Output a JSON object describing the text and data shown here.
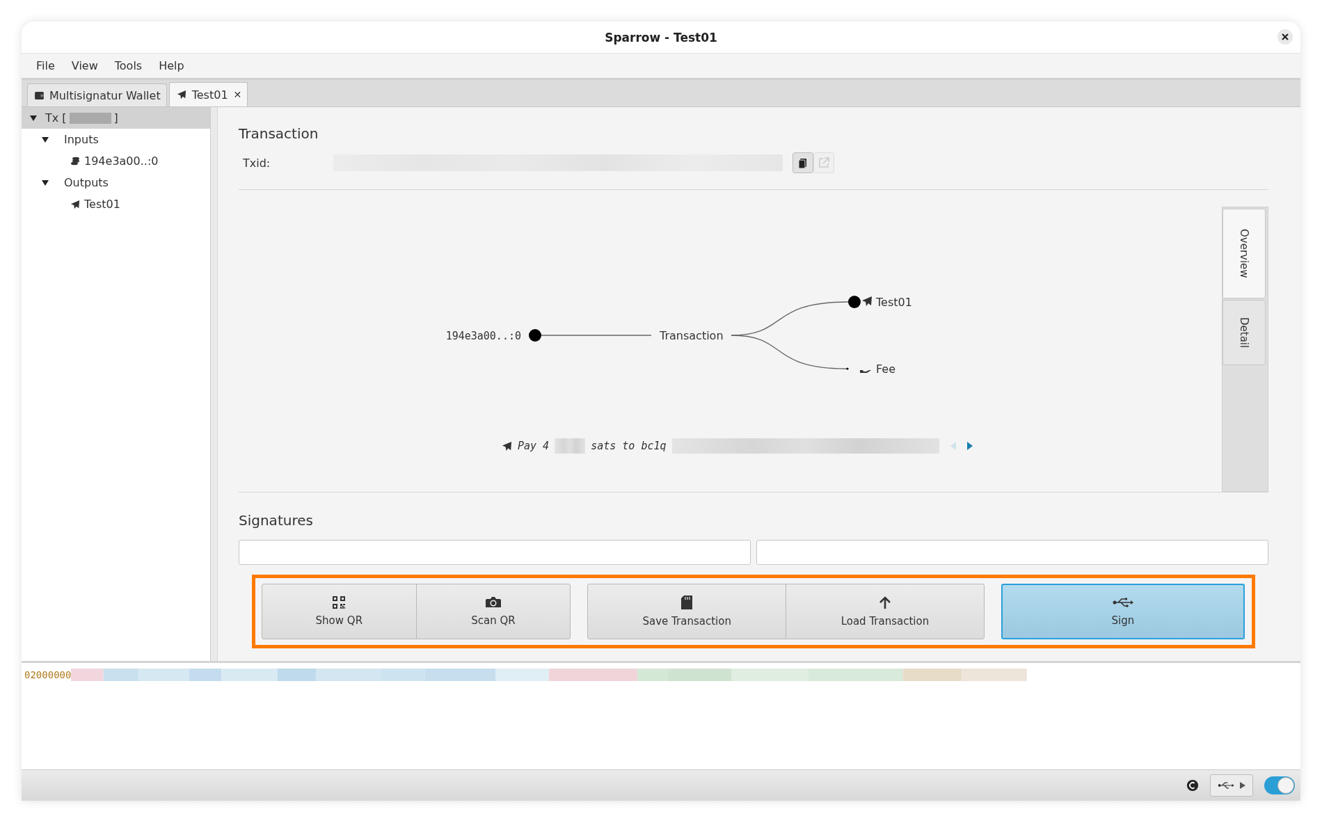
{
  "window": {
    "title": "Sparrow - Test01"
  },
  "menu": [
    "File",
    "View",
    "Tools",
    "Help"
  ],
  "tabs": [
    {
      "label": "Multisignatur Wallet",
      "selected": false
    },
    {
      "label": "Test01",
      "selected": true,
      "close": "✕"
    }
  ],
  "tree": {
    "prefix": "Tx [",
    "suffix": "]",
    "selected": true,
    "expanded": true,
    "children": [
      {
        "label": "Inputs",
        "expanded": true,
        "children": [
          {
            "label": "194e3a00..:0",
            "kind": "input"
          }
        ]
      },
      {
        "label": "Outputs",
        "expanded": true,
        "children": [
          {
            "label": "Test01",
            "kind": "output"
          }
        ]
      }
    ]
  },
  "transaction": {
    "title": "Transaction",
    "txid_label": "Txid:"
  },
  "diagram": {
    "input": "194e3a00..:0",
    "center": "Transaction",
    "outputs": [
      {
        "label": "Test01",
        "kind": "output"
      },
      {
        "label": "Fee",
        "kind": "fee"
      }
    ]
  },
  "payment": {
    "segments": [
      {
        "kind": "text",
        "text": "Pay 4"
      },
      {
        "kind": "redacted"
      },
      {
        "kind": "text",
        "text": "sats to bc1q"
      },
      {
        "kind": "redacted"
      }
    ],
    "prev_disabled": true,
    "next_disabled": false
  },
  "side_tabs": [
    {
      "label": "Overview",
      "selected": true
    },
    {
      "label": "Detail",
      "selected": false
    }
  ],
  "signatures": {
    "title": "Signatures",
    "slots": [
      {
        "level": 0
      },
      {
        "level": 0
      }
    ]
  },
  "actions": {
    "highlighted": true,
    "groups": [
      [
        {
          "label": "Show QR",
          "default": false
        },
        {
          "label": "Scan QR",
          "default": false
        }
      ],
      [
        {
          "label": "Save Transaction",
          "default": false
        },
        {
          "label": "Load Transaction",
          "default": false
        }
      ],
      [
        {
          "label": "Sign",
          "default": true
        }
      ]
    ]
  },
  "hex": {
    "text": "02000000"
  },
  "status": {
    "toggle_on": true
  }
}
